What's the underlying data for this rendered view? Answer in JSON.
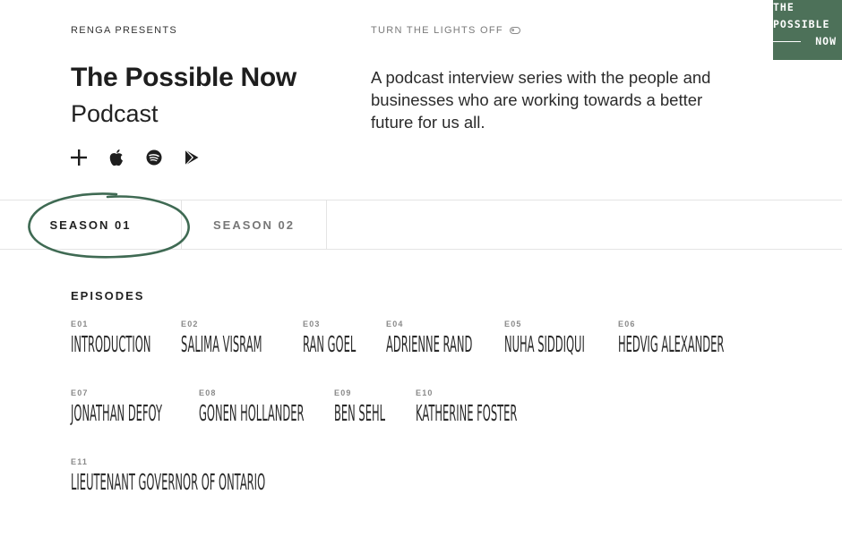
{
  "header": {
    "presenter": "RENGA PRESENTS",
    "lights_toggle": "TURN THE LIGHTS OFF"
  },
  "logo": {
    "line1": "THE",
    "line2": "POSSIBLE",
    "line3": "NOW"
  },
  "podcast": {
    "title": "The Possible Now",
    "subtitle": "Podcast",
    "description": "A podcast interview series with the people and businesses who are working towards a better future for us all.",
    "platforms": [
      "add-icon",
      "apple-podcasts-icon",
      "spotify-icon",
      "google-play-icon"
    ]
  },
  "tabs": [
    {
      "label": "SEASON 01",
      "active": true
    },
    {
      "label": "SEASON 02",
      "active": false
    }
  ],
  "episodes": {
    "heading": "EPISODES",
    "items": [
      {
        "code": "E01",
        "name": "Introduction"
      },
      {
        "code": "E02",
        "name": "Salima Visram"
      },
      {
        "code": "E03",
        "name": "Ran Goel"
      },
      {
        "code": "E04",
        "name": "Adrienne Rand"
      },
      {
        "code": "E05",
        "name": "Nuha Siddiqui"
      },
      {
        "code": "E06",
        "name": "Hedvig Alexander"
      },
      {
        "code": "E07",
        "name": "Jonathan Defoy"
      },
      {
        "code": "E08",
        "name": "Gonen Hollander"
      },
      {
        "code": "E09",
        "name": "Ben Sehl"
      },
      {
        "code": "E10",
        "name": "Katherine Foster"
      },
      {
        "code": "E11",
        "name": "Lieutenant Governor of Ontario"
      }
    ]
  },
  "colors": {
    "brand_green": "#4d7159",
    "text_dark": "#222222",
    "text_muted": "#7a7a7a"
  }
}
